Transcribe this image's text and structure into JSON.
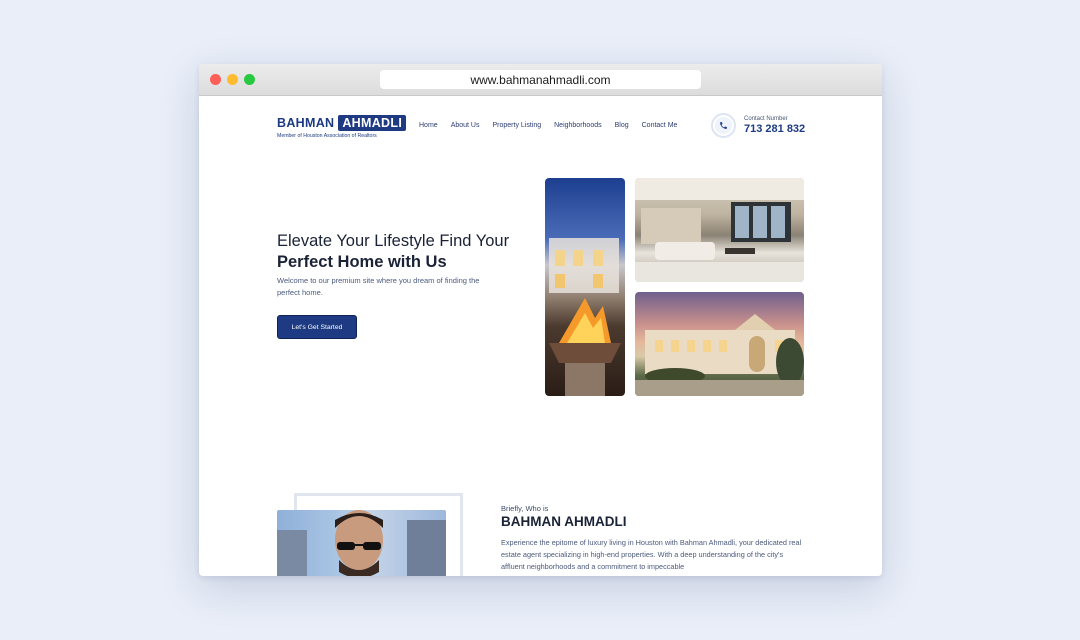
{
  "browser": {
    "url": "www.bahmanahmadli.com"
  },
  "header": {
    "logo_first": "BAHMAN",
    "logo_last": "AHMADLI",
    "logo_tagline": "Member of Houston Association of Realtors",
    "nav": [
      "Home",
      "About Us",
      "Property Listing",
      "Neighborhoods",
      "Blog",
      "Contact Me"
    ],
    "contact_label": "Contact Number",
    "contact_number": "713 281 832"
  },
  "hero": {
    "title_plain": "Elevate Your Lifestyle Find Your ",
    "title_bold": "Perfect Home with Us",
    "subtitle": "Welcome to our premium site where you dream of finding the perfect home.",
    "cta_label": "Let's Get Started"
  },
  "about": {
    "kicker": "Briefly, Who is",
    "name_bold": "BAHMAN",
    "name_rest": " AHMADLI",
    "text": "Experience the epitome of luxury living in Houston with Bahman Ahmadli, your dedicated real estate agent specializing in high-end properties. With a deep understanding of the city's affluent neighborhoods and a commitment to impeccable"
  },
  "colors": {
    "brand": "#1d3a82",
    "background": "#e9eef8"
  }
}
